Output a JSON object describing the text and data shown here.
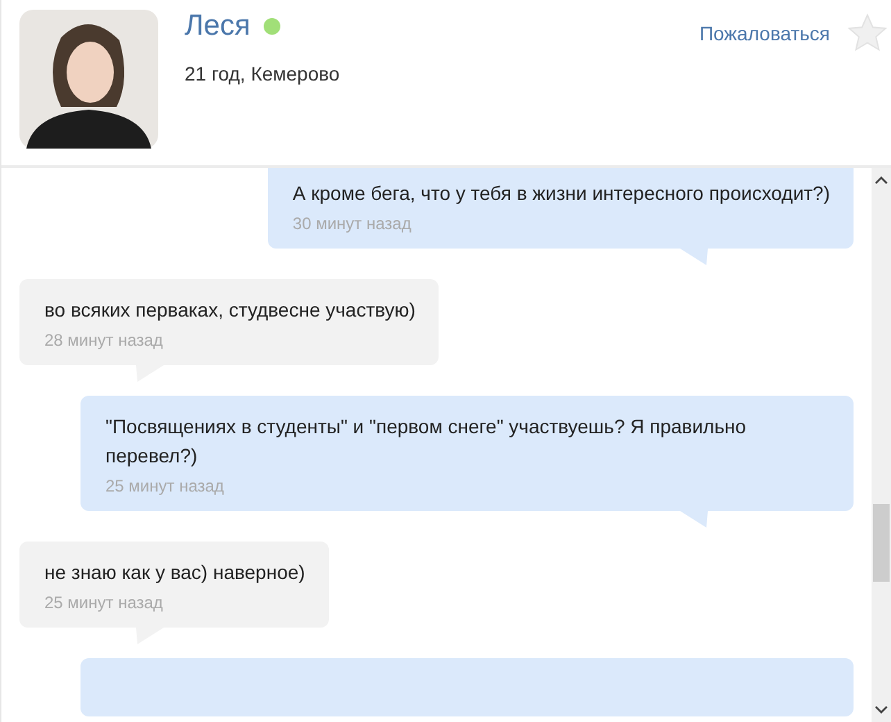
{
  "profile": {
    "name": "Леся",
    "online": true,
    "details": "21 год, Кемерово",
    "report_link": "Пожаловаться",
    "favorite": false
  },
  "messages": [
    {
      "kind": "outgoing",
      "text": "А кроме бега, что у тебя в жизни интересного происходит?)",
      "time": "30 минут назад"
    },
    {
      "kind": "incoming",
      "text": "во всяких перваках, студвесне участвую)",
      "time": "28 минут назад"
    },
    {
      "kind": "outgoing",
      "text": "\"Посвящениях в студенты\" и \"первом снеге\" участвуешь? Я правильно перевел?)",
      "time": "25 минут назад"
    },
    {
      "kind": "incoming",
      "text": "не знаю как у вас) наверное)",
      "time": "25 минут назад"
    },
    {
      "kind": "outgoing"
    }
  ]
}
